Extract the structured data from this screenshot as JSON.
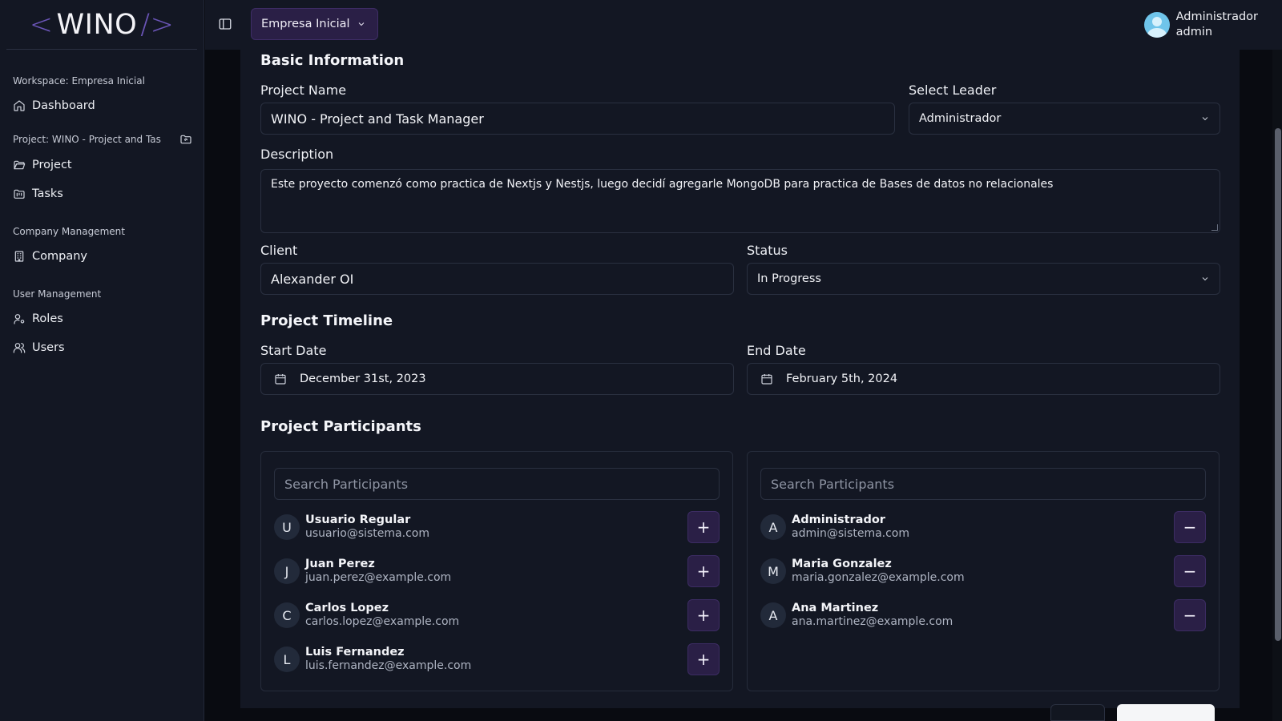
{
  "brand": {
    "bracket_left": "<",
    "name": "WINO",
    "bracket_right": "/>"
  },
  "sidebar": {
    "workspace_label": "Workspace: Empresa Inicial",
    "dashboard": "Dashboard",
    "project_label": "Project: WINO - Project and Tas",
    "project": "Project",
    "tasks": "Tasks",
    "company_label": "Company Management",
    "company": "Company",
    "user_label": "User Management",
    "roles": "Roles",
    "users": "Users"
  },
  "topbar": {
    "company_selector": "Empresa Inicial",
    "user_name": "Administrador",
    "user_role": "admin"
  },
  "form": {
    "basic_title": "Basic Information",
    "project_name_label": "Project Name",
    "project_name_value": "WINO - Project and Task Manager",
    "leader_label": "Select Leader",
    "leader_value": "Administrador",
    "description_label": "Description",
    "description_value": "Este proyecto comenzó como practica de Nextjs y Nestjs, luego decidí agregarle MongoDB para practica de Bases de datos no relacionales",
    "client_label": "Client",
    "client_value": "Alexander OI",
    "status_label": "Status",
    "status_value": "In Progress",
    "timeline_title": "Project Timeline",
    "start_label": "Start Date",
    "start_value": "December 31st, 2023",
    "end_label": "End Date",
    "end_value": "February 5th, 2024",
    "participants_title": "Project Participants"
  },
  "participants": {
    "search_placeholder": "Search Participants",
    "available": [
      {
        "initial": "U",
        "name": "Usuario Regular",
        "email": "usuario@sistema.com",
        "action": "+"
      },
      {
        "initial": "J",
        "name": "Juan Perez",
        "email": "juan.perez@example.com",
        "action": "+"
      },
      {
        "initial": "C",
        "name": "Carlos Lopez",
        "email": "carlos.lopez@example.com",
        "action": "+"
      },
      {
        "initial": "L",
        "name": "Luis Fernandez",
        "email": "luis.fernandez@example.com",
        "action": "+"
      }
    ],
    "selected": [
      {
        "initial": "A",
        "name": "Administrador",
        "email": "admin@sistema.com",
        "action": "−"
      },
      {
        "initial": "M",
        "name": "Maria Gonzalez",
        "email": "maria.gonzalez@example.com",
        "action": "−"
      },
      {
        "initial": "A",
        "name": "Ana Martinez",
        "email": "ana.martinez@example.com",
        "action": "−"
      }
    ]
  },
  "colors": {
    "background": "#090b11",
    "panel": "#131723",
    "accent": "#2a1f46",
    "brand_bracket": "#6b55b8"
  }
}
